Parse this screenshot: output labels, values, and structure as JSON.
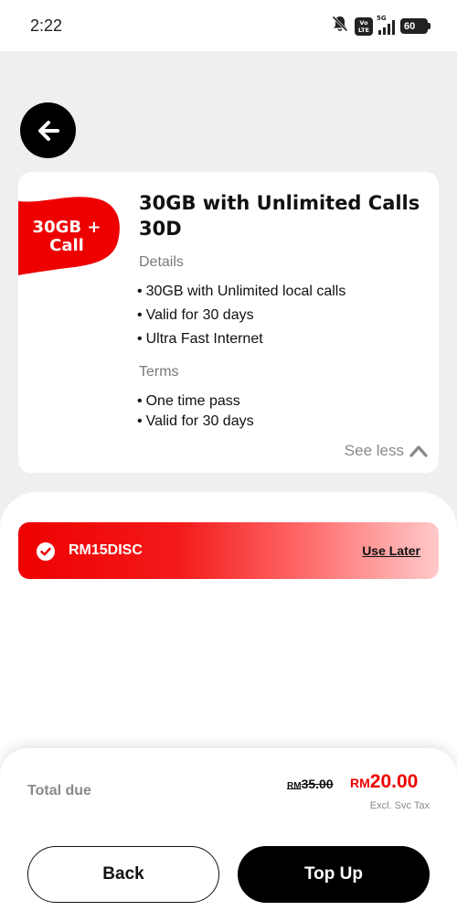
{
  "status_bar": {
    "time": "2:22",
    "volte": "Vo LTE",
    "network": "5G",
    "battery": "60"
  },
  "nav": {
    "back_icon": "arrow-left-icon"
  },
  "plan": {
    "badge_line1": "30GB +",
    "badge_line2": "Call",
    "title": "30GB with Unlimited Calls 30D",
    "details_label": "Details",
    "details": [
      "30GB with Unlimited local calls",
      "Valid for 30 days",
      "Ultra Fast Internet"
    ],
    "terms_label": "Terms",
    "terms": [
      "One time pass",
      "Valid for 30 days"
    ],
    "see_less": "See less"
  },
  "voucher": {
    "code": "RM15DISC",
    "action": "Use Later",
    "check_icon": "check-circle-icon"
  },
  "summary": {
    "total_label": "Total due",
    "old_currency": "RM",
    "old_price": "35.00",
    "new_currency": "RM",
    "new_price": "20.00",
    "tax_note": "Excl. Svc Tax"
  },
  "buttons": {
    "back": "Back",
    "top_up": "Top Up"
  },
  "colors": {
    "accent": "#ee0000",
    "dark": "#000000",
    "muted": "#8a8a8a"
  }
}
